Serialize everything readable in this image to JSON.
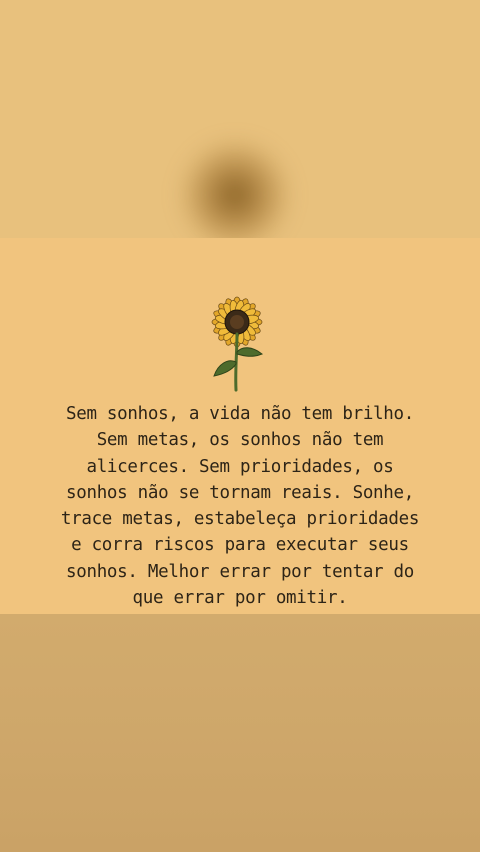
{
  "colors": {
    "top_background": "#e8c17d",
    "card_background": "#f1c47e",
    "bottom_background": "#cfa86b",
    "text": "#2d2417",
    "petal": "#e3a72a",
    "flower_center": "#3b2a18",
    "stem": "#4d6b2c"
  },
  "quote": {
    "lines": [
      "Sem sonhos, a vida não tem brilho.",
      "Sem metas, os sonhos não tem",
      "alicerces. Sem prioridades, os",
      "sonhos não se tornam reais. Sonhe,",
      "trace metas, estabeleça prioridades",
      "e corra riscos para executar seus",
      "sonhos. Melhor errar por tentar do",
      "que errar por omitir."
    ]
  },
  "illustration": {
    "icon": "sunflower-icon"
  }
}
